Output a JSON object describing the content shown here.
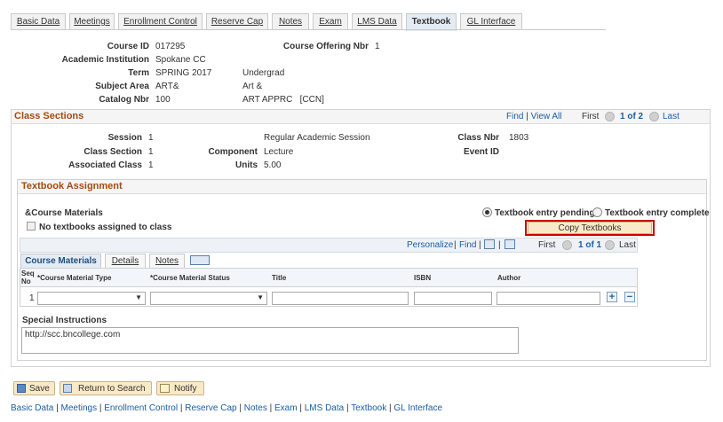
{
  "tabs": [
    "Basic Data",
    "Meetings",
    "Enrollment Control",
    "Reserve Cap",
    "Notes",
    "Exam",
    "LMS Data",
    "Textbook",
    "GL Interface"
  ],
  "active_tab": "Textbook",
  "header": {
    "course_id_label": "Course ID",
    "course_id": "017295",
    "offering_label": "Course Offering Nbr",
    "offering": "1",
    "institution_label": "Academic Institution",
    "institution": "Spokane CC",
    "term_label": "Term",
    "term": "SPRING 2017",
    "career": "Undergrad",
    "subject_label": "Subject Area",
    "subject": "ART&",
    "subject_desc": "Art &",
    "catalog_label": "Catalog Nbr",
    "catalog": "100",
    "catalog_desc": "ART APPRC   [CCN]"
  },
  "class_sections": {
    "title": "Class Sections",
    "find": "Find",
    "view_all": "View All",
    "first": "First",
    "count": "1 of 2",
    "last": "Last",
    "session_label": "Session",
    "session": "1",
    "session_desc": "Regular Academic Session",
    "class_nbr_label": "Class Nbr",
    "class_nbr": "1803",
    "class_section_label": "Class Section",
    "class_section": "1",
    "component_label": "Component",
    "component": "Lecture",
    "event_id_label": "Event ID",
    "assoc_label": "Associated Class",
    "assoc": "1",
    "units_label": "Units",
    "units": "5.00"
  },
  "textbook": {
    "title": "Textbook Assignment",
    "course_materials_label": "&Course Materials",
    "no_textbooks_label": "No textbooks assigned to class",
    "pending_label": "Textbook entry pending",
    "complete_label": "Textbook entry complete",
    "copy_button": "Copy Textbooks",
    "personalize": "Personalize",
    "find": "Find",
    "first": "First",
    "count": "1 of 1",
    "last": "Last",
    "subtabs": [
      "Course Materials",
      "Details",
      "Notes"
    ],
    "columns": {
      "seq_a": "Seq",
      "seq_b": "No",
      "type": "*Course Material Type",
      "status": "*Course Material Status",
      "title": "Title",
      "isbn": "ISBN",
      "author": "Author"
    },
    "row": {
      "seq": "1"
    },
    "special_label": "Special Instructions",
    "special_text": "http://scc.bncollege.com"
  },
  "buttons": {
    "save": "Save",
    "return": "Return to Search",
    "notify": "Notify"
  },
  "footer_links": [
    "Basic Data",
    "Meetings",
    "Enrollment Control",
    "Reserve Cap",
    "Notes",
    "Exam",
    "LMS Data",
    "Textbook",
    "GL Interface"
  ],
  "colors": {
    "section_title": "#a04c14",
    "link": "#1a5ea6",
    "button_bg": "#f9e9c6",
    "copy_border": "#cc0000"
  }
}
